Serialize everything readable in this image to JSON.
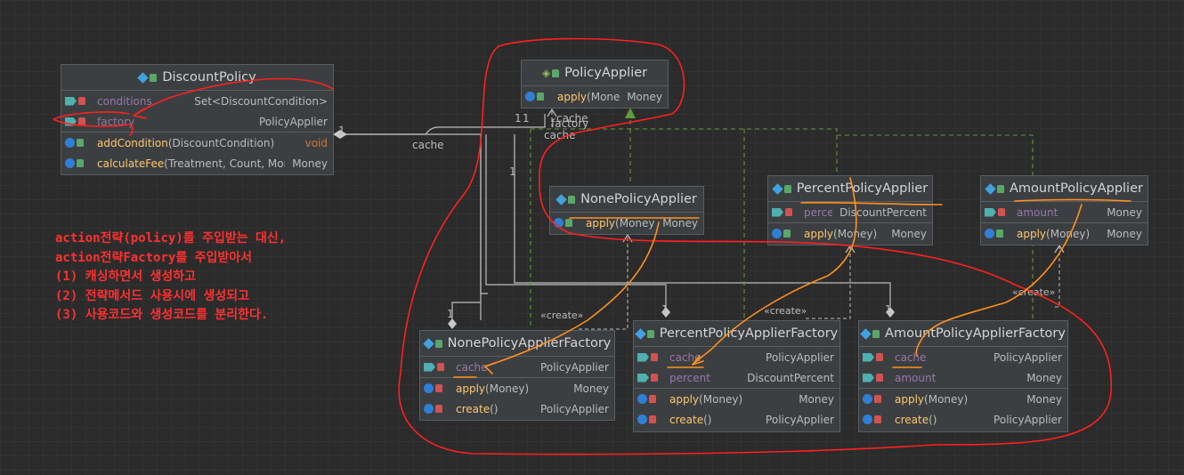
{
  "classes": {
    "discount_policy": {
      "name": "DiscountPolicy",
      "fields": [
        {
          "name": "conditions",
          "type": "Set<DiscountCondition>"
        },
        {
          "name": "factory",
          "type": "PolicyApplier"
        }
      ],
      "methods": [
        {
          "name": "addCondition",
          "args": "(DiscountCondition)",
          "type": "void"
        },
        {
          "name": "calculateFee",
          "args": "(Treatment, Count, Money)",
          "type": "Money"
        }
      ]
    },
    "policy_applier": {
      "name": "PolicyApplier",
      "methods": [
        {
          "name": "apply",
          "args": "(Money)",
          "type": "Money"
        }
      ]
    },
    "none_policy_applier": {
      "name": "NonePolicyApplier",
      "methods": [
        {
          "name": "apply",
          "args": "(Money)",
          "type": "Money"
        }
      ]
    },
    "percent_policy_applier": {
      "name": "PercentPolicyApplier",
      "fields": [
        {
          "name": "percent",
          "type": "DiscountPercent"
        }
      ],
      "methods": [
        {
          "name": "apply",
          "args": "(Money)",
          "type": "Money"
        }
      ]
    },
    "amount_policy_applier": {
      "name": "AmountPolicyApplier",
      "fields": [
        {
          "name": "amount",
          "type": "Money"
        }
      ],
      "methods": [
        {
          "name": "apply",
          "args": "(Money)",
          "type": "Money"
        }
      ]
    },
    "none_factory": {
      "name": "NonePolicyApplierFactory",
      "fields": [
        {
          "name": "cache",
          "type": "PolicyApplier"
        }
      ],
      "methods": [
        {
          "name": "apply",
          "args": "(Money)",
          "type": "Money"
        },
        {
          "name": "create",
          "args": "()",
          "type": "PolicyApplier"
        }
      ]
    },
    "percent_factory": {
      "name": "PercentPolicyApplierFactory",
      "fields": [
        {
          "name": "cache",
          "type": "PolicyApplier"
        },
        {
          "name": "percent",
          "type": "DiscountPercent"
        }
      ],
      "methods": [
        {
          "name": "apply",
          "args": "(Money)",
          "type": "Money"
        },
        {
          "name": "create",
          "args": "()",
          "type": "PolicyApplier"
        }
      ]
    },
    "amount_factory": {
      "name": "AmountPolicyApplierFactory",
      "fields": [
        {
          "name": "cache",
          "type": "PolicyApplier"
        },
        {
          "name": "amount",
          "type": "Money"
        }
      ],
      "methods": [
        {
          "name": "apply",
          "args": "(Money)",
          "type": "Money"
        },
        {
          "name": "create",
          "args": "()",
          "type": "PolicyApplier"
        }
      ]
    }
  },
  "edge_labels": {
    "cache": "cache",
    "factory": "factory",
    "one": "1",
    "create": "«create»"
  },
  "annotation": [
    "action전략(policy)를 주입받는 대신,",
    "action전략Factory를 주입받아서",
    "(1) 캐싱하면서 생성하고",
    "(2) 전략메서드 사용시에 생성되고",
    "(3) 사용코드와 생성코드를 분리한다."
  ],
  "colors": {
    "background": "#2b2b2b",
    "box": "#3c3f41",
    "field": "#9876aa",
    "method": "#ffc66d",
    "red_markup": "#ff2020",
    "orange_markup": "#ff9020",
    "realization": "#5f9a3c"
  }
}
